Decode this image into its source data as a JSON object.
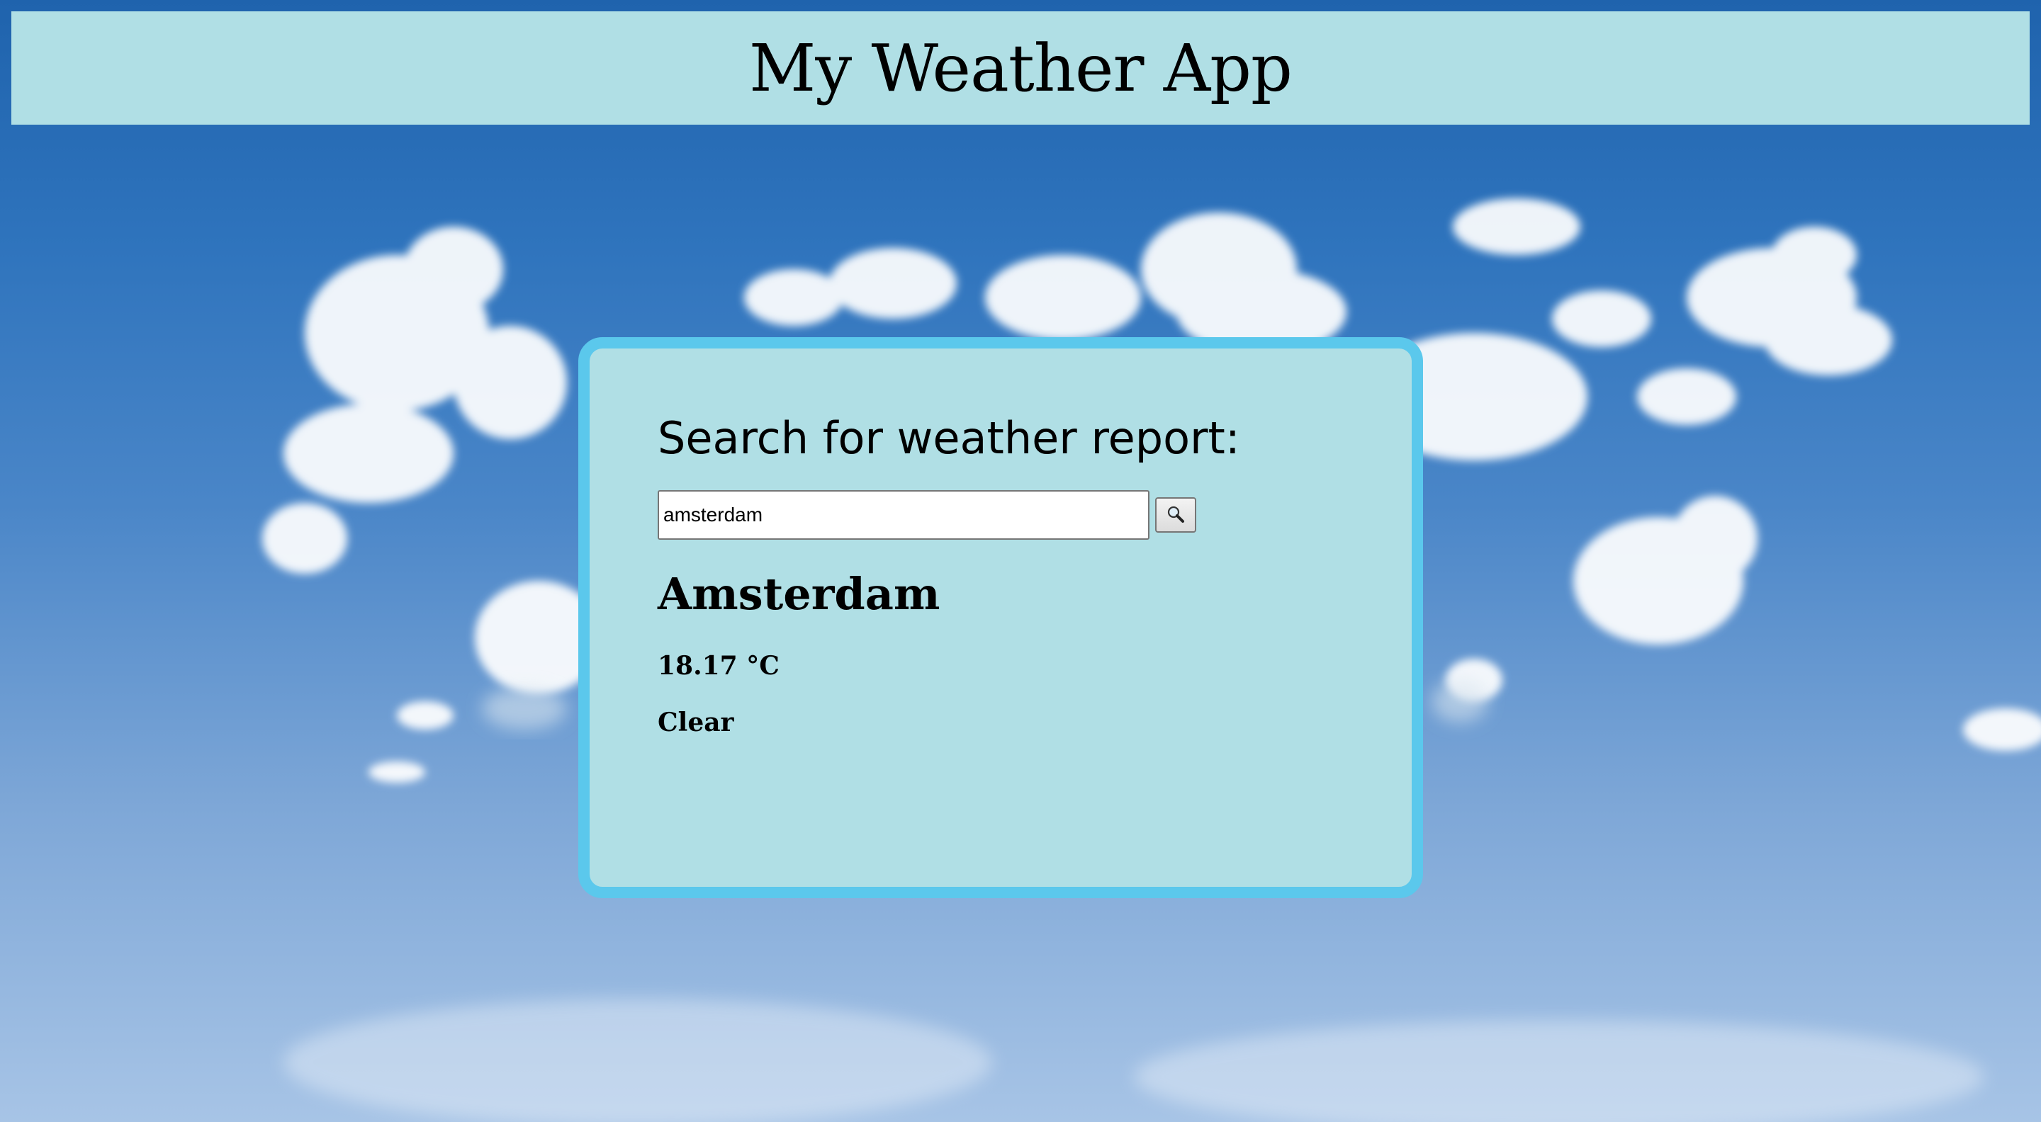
{
  "header": {
    "title": "My Weather App"
  },
  "search": {
    "heading": "Search for weather report:",
    "value": "amsterdam",
    "button_icon": "magnifier-icon"
  },
  "result": {
    "city": "Amsterdam",
    "temperature": "18.17 °C",
    "description": "Clear"
  },
  "colors": {
    "panel_bg": "#b0dfe5",
    "card_border": "#5bc8ec",
    "sky": "#2f74bd"
  }
}
